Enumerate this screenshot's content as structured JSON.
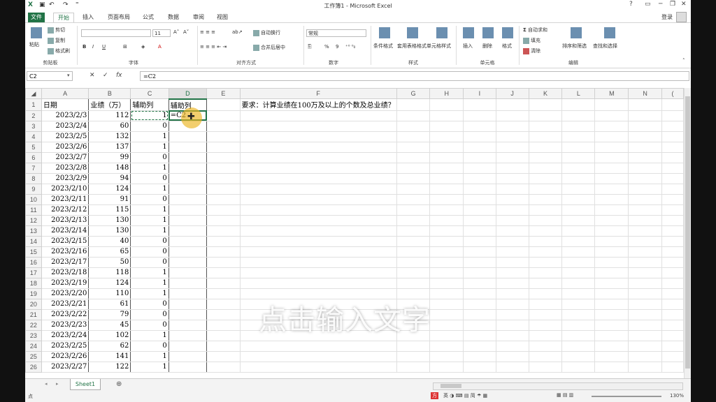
{
  "title_bar": {
    "window_title": "工作簿1 - Microsoft Excel",
    "help": "?",
    "minimize": "─",
    "restore": "❐",
    "close": "✕"
  },
  "ribbon_tabs": [
    "文件",
    "开始",
    "插入",
    "页面布局",
    "公式",
    "数据",
    "审阅",
    "视图"
  ],
  "login": "登录",
  "ribbon": {
    "clipboard": {
      "paste": "粘贴",
      "cut": "剪切",
      "copy": "复制",
      "format_painter": "格式刷",
      "label": "剪贴板"
    },
    "font": {
      "font_size": "11",
      "bold": "B",
      "italic": "I",
      "underline": "U",
      "label": "字体"
    },
    "alignment": {
      "wrap": "自动换行",
      "merge": "合并后居中",
      "label": "对齐方式"
    },
    "number": {
      "format": "常规",
      "percent": "%",
      "comma": "9",
      "label": "数字"
    },
    "styles": {
      "conditional": "条件格式",
      "table": "套用表格格式",
      "cell_styles": "单元格样式",
      "label": "样式"
    },
    "cells": {
      "insert": "插入",
      "delete": "删除",
      "format": "格式",
      "label": "单元格"
    },
    "editing": {
      "autosum": "自动求和",
      "fill": "填充",
      "clear": "清除",
      "sort": "排序和筛选",
      "find": "查找和选择",
      "label": "编辑"
    }
  },
  "formula_bar": {
    "name_box": "C2",
    "cancel": "✕",
    "enter": "✓",
    "fx": "fx",
    "formula": "=C2"
  },
  "columns": [
    "A",
    "B",
    "C",
    "D",
    "E",
    "F",
    "G",
    "H",
    "I",
    "J",
    "K",
    "L",
    "M",
    "N",
    "("
  ],
  "header_row": {
    "A": "日期",
    "B": "业绩（万）",
    "C": "辅助列",
    "D": "辅助列"
  },
  "requirement": "要求：计算业绩在100万及以上的个数及总业绩？",
  "rows": [
    {
      "n": "2",
      "date": "2023/2/3",
      "value": "112",
      "flag": "1",
      "d": "=C2"
    },
    {
      "n": "3",
      "date": "2023/2/4",
      "value": "60",
      "flag": "0",
      "d": ""
    },
    {
      "n": "4",
      "date": "2023/2/5",
      "value": "132",
      "flag": "1",
      "d": ""
    },
    {
      "n": "5",
      "date": "2023/2/6",
      "value": "137",
      "flag": "1",
      "d": ""
    },
    {
      "n": "6",
      "date": "2023/2/7",
      "value": "99",
      "flag": "0",
      "d": ""
    },
    {
      "n": "7",
      "date": "2023/2/8",
      "value": "148",
      "flag": "1",
      "d": ""
    },
    {
      "n": "8",
      "date": "2023/2/9",
      "value": "94",
      "flag": "0",
      "d": ""
    },
    {
      "n": "9",
      "date": "2023/2/10",
      "value": "124",
      "flag": "1",
      "d": ""
    },
    {
      "n": "10",
      "date": "2023/2/11",
      "value": "91",
      "flag": "0",
      "d": ""
    },
    {
      "n": "11",
      "date": "2023/2/12",
      "value": "115",
      "flag": "1",
      "d": ""
    },
    {
      "n": "12",
      "date": "2023/2/13",
      "value": "130",
      "flag": "1",
      "d": ""
    },
    {
      "n": "13",
      "date": "2023/2/14",
      "value": "130",
      "flag": "1",
      "d": ""
    },
    {
      "n": "14",
      "date": "2023/2/15",
      "value": "40",
      "flag": "0",
      "d": ""
    },
    {
      "n": "15",
      "date": "2023/2/16",
      "value": "65",
      "flag": "0",
      "d": ""
    },
    {
      "n": "16",
      "date": "2023/2/17",
      "value": "50",
      "flag": "0",
      "d": ""
    },
    {
      "n": "17",
      "date": "2023/2/18",
      "value": "118",
      "flag": "1",
      "d": ""
    },
    {
      "n": "18",
      "date": "2023/2/19",
      "value": "124",
      "flag": "1",
      "d": ""
    },
    {
      "n": "19",
      "date": "2023/2/20",
      "value": "110",
      "flag": "1",
      "d": ""
    },
    {
      "n": "20",
      "date": "2023/2/21",
      "value": "61",
      "flag": "0",
      "d": ""
    },
    {
      "n": "21",
      "date": "2023/2/22",
      "value": "79",
      "flag": "0",
      "d": ""
    },
    {
      "n": "22",
      "date": "2023/2/23",
      "value": "45",
      "flag": "0",
      "d": ""
    },
    {
      "n": "23",
      "date": "2023/2/24",
      "value": "102",
      "flag": "1",
      "d": ""
    },
    {
      "n": "24",
      "date": "2023/2/25",
      "value": "62",
      "flag": "0",
      "d": ""
    },
    {
      "n": "25",
      "date": "2023/2/26",
      "value": "141",
      "flag": "1",
      "d": ""
    },
    {
      "n": "26",
      "date": "2023/2/27",
      "value": "122",
      "flag": "1",
      "d": ""
    }
  ],
  "sheet_tab": "Sheet1",
  "status_left": "点",
  "zoom": "130%",
  "overlay_text": "点击输入文字",
  "colors": {
    "excel_green": "#217346"
  }
}
